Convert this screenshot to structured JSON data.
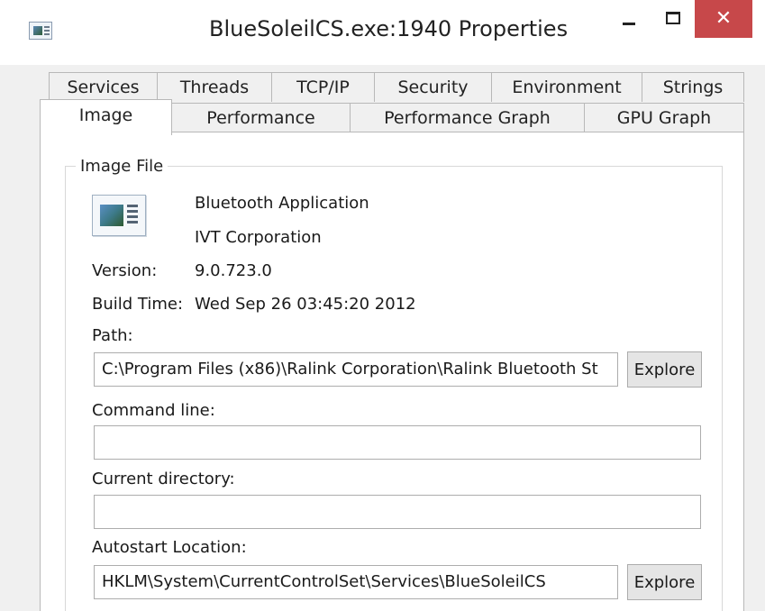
{
  "window": {
    "title": "BlueSoleilCS.exe:1940 Properties",
    "icons": {
      "app": "app-window-icon",
      "minimize": "minimize-icon",
      "maximize": "maximize-icon",
      "close": "close-icon"
    },
    "close_glyph": "✕",
    "colors": {
      "close_bg": "#c7484a",
      "tab_bg": "#f0f0f0",
      "panel_bg": "#ffffff"
    }
  },
  "tabs": {
    "row1": [
      "Services",
      "Threads",
      "TCP/IP",
      "Security",
      "Environment",
      "Strings"
    ],
    "row2": [
      "Image",
      "Performance",
      "Performance Graph",
      "GPU Graph"
    ],
    "active": "Image"
  },
  "image_file": {
    "group_label": "Image File",
    "icon": "application-file-icon",
    "description": "Bluetooth Application",
    "company": "IVT Corporation",
    "version_label": "Version:",
    "version": "9.0.723.0",
    "build_time_label": "Build Time:",
    "build_time": "Wed Sep 26 03:45:20 2012",
    "path_label": "Path:",
    "path": "C:\\Program Files (x86)\\Ralink Corporation\\Ralink Bluetooth St",
    "explore_label": "Explore",
    "command_line_label": "Command line:",
    "command_line": "",
    "current_directory_label": "Current directory:",
    "current_directory": "",
    "autostart_label": "Autostart Location:",
    "autostart": "HKLM\\System\\CurrentControlSet\\Services\\BlueSoleilCS",
    "autostart_explore_label": "Explore"
  }
}
